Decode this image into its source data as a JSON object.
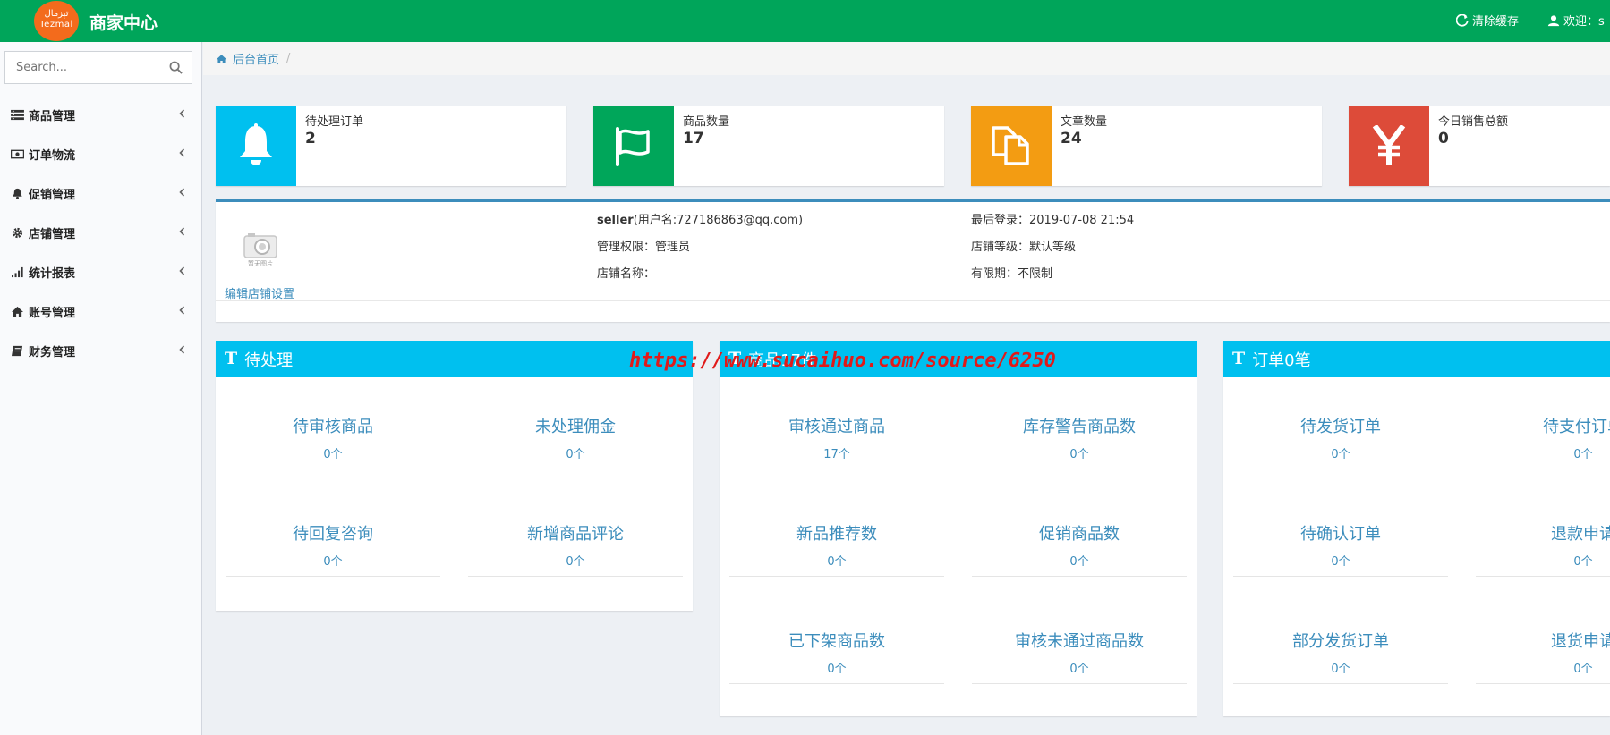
{
  "header": {
    "logo_text_top": "تېزمال",
    "logo_text_bottom": "Tezmal",
    "brand": "商家中心",
    "clear_cache": "清除缓存",
    "welcome": "欢迎：s"
  },
  "sidebar": {
    "search_placeholder": "Search...",
    "items": [
      {
        "label": "商品管理",
        "icon": "list-icon"
      },
      {
        "label": "订单物流",
        "icon": "money-icon"
      },
      {
        "label": "促销管理",
        "icon": "bell-icon"
      },
      {
        "label": "店铺管理",
        "icon": "gear-icon"
      },
      {
        "label": "统计报表",
        "icon": "signal-icon"
      },
      {
        "label": "账号管理",
        "icon": "home-icon"
      },
      {
        "label": "财务管理",
        "icon": "book-icon"
      }
    ]
  },
  "breadcrumb": {
    "home": "后台首页",
    "sep": "/"
  },
  "stats": [
    {
      "label": "待处理订单",
      "value": "2",
      "color": "#00c0ef",
      "icon": "bell-icon"
    },
    {
      "label": "商品数量",
      "value": "17",
      "color": "#00a65a",
      "icon": "flag-icon"
    },
    {
      "label": "文章数量",
      "value": "24",
      "color": "#f39c12",
      "icon": "files-icon"
    },
    {
      "label": "今日销售总额",
      "value": "0",
      "color": "#dd4b39",
      "icon": "yen-icon"
    }
  ],
  "info": {
    "avatar_caption": "暂无图片",
    "edit_link": "编辑店铺设置",
    "seller_name": "seller",
    "seller_user": "(用户名:727186863@qq.com)",
    "role": "管理权限：管理员",
    "shop_name": "店铺名称：",
    "last_login": "最后登录：2019-07-08 21:54",
    "shop_level": "店铺等级：默认等级",
    "validity": "有限期：不限制"
  },
  "panels": [
    {
      "title": "待处理",
      "cells": [
        {
          "label": "待审核商品",
          "value": "0个"
        },
        {
          "label": "未处理佣金",
          "value": "0个"
        },
        {
          "label": "待回复咨询",
          "value": "0个"
        },
        {
          "label": "新增商品评论",
          "value": "0个"
        }
      ]
    },
    {
      "title": "商品17件",
      "cells": [
        {
          "label": "审核通过商品",
          "value": "17个"
        },
        {
          "label": "库存警告商品数",
          "value": "0个"
        },
        {
          "label": "新品推荐数",
          "value": "0个"
        },
        {
          "label": "促销商品数",
          "value": "0个"
        },
        {
          "label": "已下架商品数",
          "value": "0个"
        },
        {
          "label": "审核未通过商品数",
          "value": "0个"
        }
      ]
    },
    {
      "title": "订单0笔",
      "cells": [
        {
          "label": "待发货订单",
          "value": "0个"
        },
        {
          "label": "待支付订单",
          "value": "0个"
        },
        {
          "label": "待确认订单",
          "value": "0个"
        },
        {
          "label": "退款申请",
          "value": "0个"
        },
        {
          "label": "部分发货订单",
          "value": "0个"
        },
        {
          "label": "退货申请",
          "value": "0个"
        }
      ]
    }
  ],
  "watermark": "https://www.sucaihuo.com/source/6250"
}
